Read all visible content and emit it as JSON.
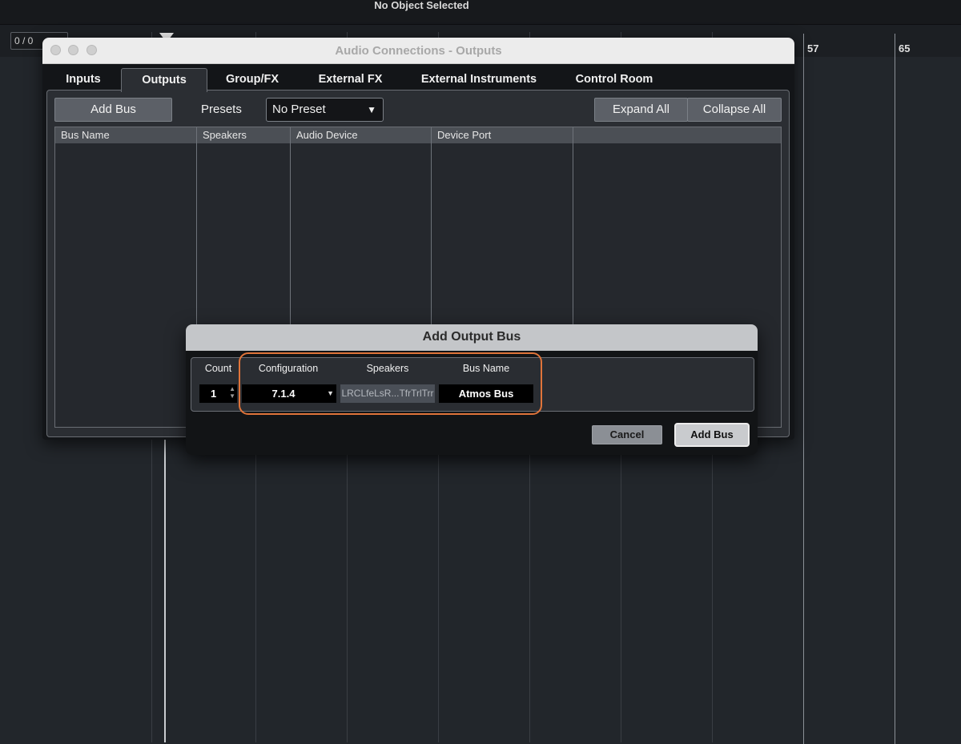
{
  "status": {
    "text": "No Object Selected"
  },
  "ruler": {
    "counter": "0 / 0",
    "bars": [
      "57",
      "65"
    ]
  },
  "audio_connections": {
    "title": "Audio Connections - Outputs",
    "tabs": [
      "Inputs",
      "Outputs",
      "Group/FX",
      "External FX",
      "External Instruments",
      "Control Room"
    ],
    "active_tab": "Outputs",
    "add_bus_label": "Add Bus",
    "presets_label": "Presets",
    "preset_value": "No Preset",
    "expand_all_label": "Expand All",
    "collapse_all_label": "Collapse All",
    "columns": [
      "Bus Name",
      "Speakers",
      "Audio Device",
      "Device Port",
      ""
    ]
  },
  "add_output_bus": {
    "title": "Add Output Bus",
    "headers": {
      "count": "Count",
      "configuration": "Configuration",
      "speakers": "Speakers",
      "bus_name": "Bus Name"
    },
    "count": "1",
    "configuration": "7.1.4",
    "speakers": "LRCLfeLsR...TfrTrlTrr",
    "bus_name": "Atmos Bus",
    "cancel_label": "Cancel",
    "add_bus_label": "Add Bus"
  },
  "colors": {
    "highlight": "#e0743a",
    "background": "#22262b"
  }
}
